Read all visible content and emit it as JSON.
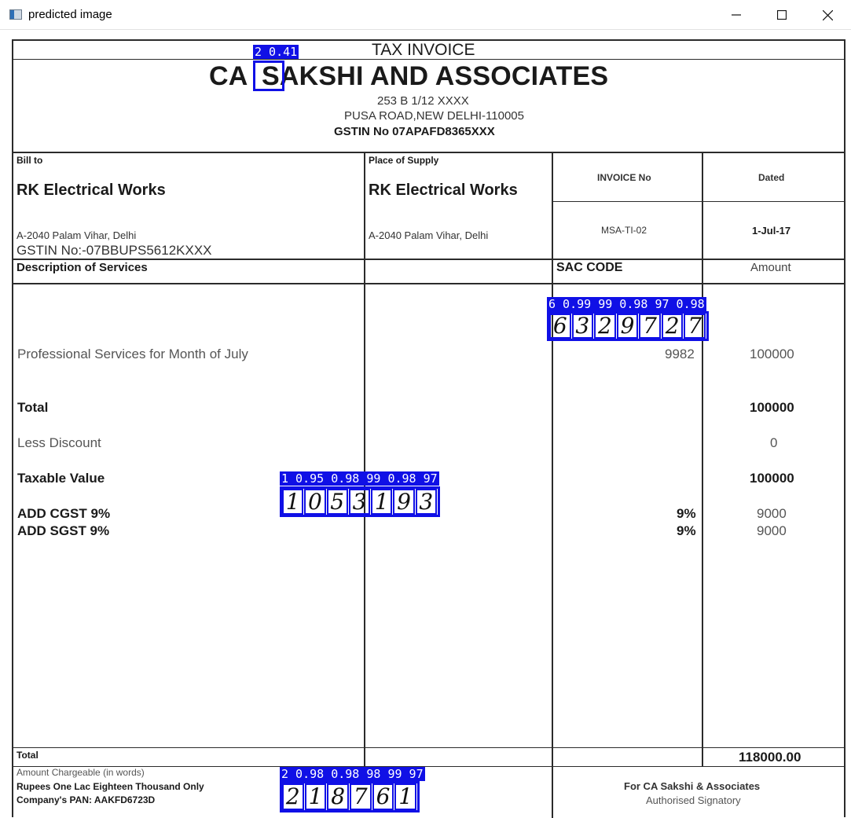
{
  "window": {
    "title": "predicted image",
    "icons": [
      "app-icon",
      "minimize-icon",
      "maximize-icon",
      "close-icon"
    ]
  },
  "invoice": {
    "heading": "TAX INVOICE",
    "company": "CA SAKSHI AND ASSOCIATES",
    "company_prefix": "CA",
    "company_suffix": "SAKSHI AND ASSOCIATES",
    "address1": "253 B 1/12 XXXX",
    "address2": "PUSA ROAD,NEW DELHI-110005",
    "gstin": "GSTIN No 07APAFD8365XXX",
    "bill_to": {
      "label": "Bill to",
      "name": "RK Electrical Works",
      "address": "A-2040 Palam Vihar, Delhi",
      "gstin": "GSTIN No:-07BBUPS5612KXXX"
    },
    "place_of_supply": {
      "label": "Place of Supply",
      "name": "RK Electrical Works",
      "address": "A-2040 Palam Vihar, Delhi"
    },
    "invoice_no_label": "INVOICE No",
    "invoice_no": "MSA-TI-02",
    "dated_label": "Dated",
    "dated": "1-Jul-17",
    "columns": {
      "description": "Description of Services",
      "sac": "SAC CODE",
      "amount": "Amount"
    },
    "service": {
      "description": "Professional Services for Month of July",
      "sac": "9982",
      "amount": "100000"
    },
    "total_label": "Total",
    "total_value": "100000",
    "discount_label": "Less Discount",
    "discount_value": "0",
    "taxable_label": "Taxable Value",
    "taxable_value": "100000",
    "cgst_label": "ADD CGST 9%",
    "cgst_rate": "9%",
    "cgst_value": "9000",
    "sgst_label": "ADD SGST 9%",
    "sgst_rate": "9%",
    "sgst_value": "9000",
    "grand_total_label": "Total",
    "grand_total_value": "118000.00",
    "amount_words_label": "Amount Chargeable (in words)",
    "amount_words": "Rupees One Lac Eighteen Thousand Only",
    "pan": "Company's PAN: AAKFD6723D",
    "for_company": "For CA Sakshi & Associates",
    "signatory": "Authorised Signatory"
  },
  "detections": {
    "box_color": "#1010e6",
    "letter": {
      "label": "2 0.41"
    },
    "top_sequence": {
      "label": "6 0.99 99 0.98 97 0.98",
      "digits": [
        "6",
        "3",
        "2",
        "9",
        "7",
        "2",
        "7"
      ]
    },
    "middle_sequence": {
      "label": "1 0.95 0.98 99 0.98 97",
      "digits": [
        "1",
        "0",
        "5",
        "3",
        "1",
        "9",
        "3"
      ]
    },
    "bottom_sequence": {
      "label": "2 0.98 0.98 98 99 97",
      "digits": [
        "2",
        "1",
        "8",
        "7",
        "6",
        "1"
      ]
    }
  }
}
